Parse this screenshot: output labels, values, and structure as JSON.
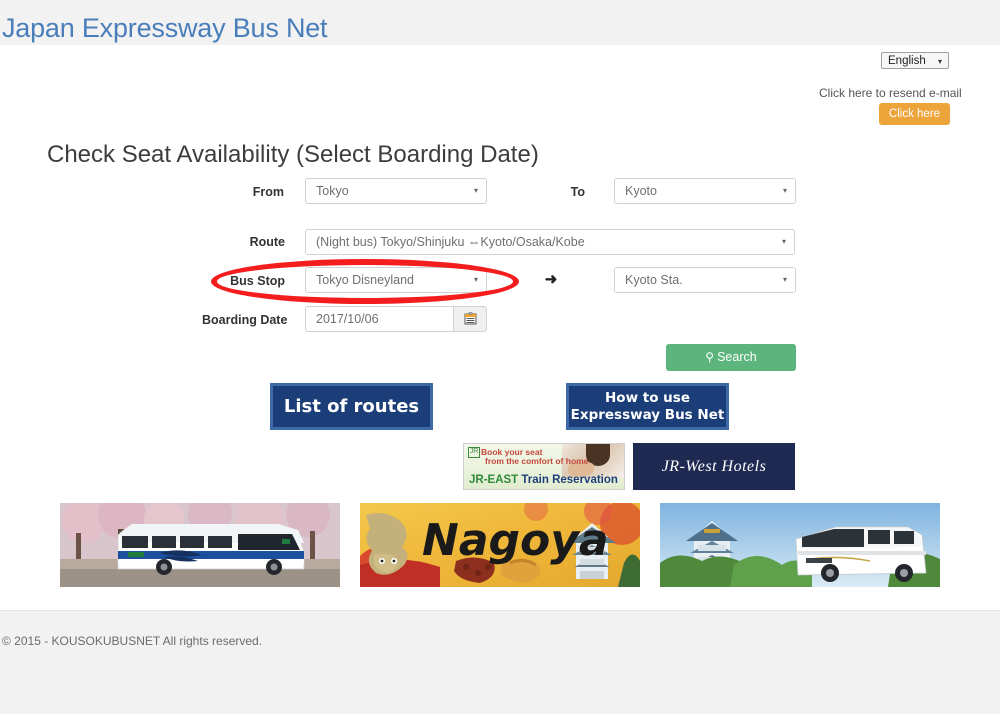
{
  "header": {
    "site_title": "Japan Expressway Bus Net"
  },
  "language": {
    "selected": "English",
    "caret": "▾"
  },
  "resend": {
    "text": "Click here to resend e-mail",
    "button_label": "Click here"
  },
  "main": {
    "heading": "Check Seat Availability (Select Boarding Date)",
    "fields": {
      "from_label": "From",
      "from_value": "Tokyo",
      "to_label": "To",
      "to_value": "Kyoto",
      "route_label": "Route",
      "route_value": "(Night bus) Tokyo/Shinjuku ⇔Kyoto/Osaka/Kobe",
      "bus_stop_label": "Bus Stop",
      "bus_stop_from_value": "Tokyo Disneyland",
      "bus_stop_arrow": "➜",
      "bus_stop_to_value": "Kyoto Sta.",
      "boarding_date_label": "Boarding Date",
      "boarding_date_value": "2017/10/06",
      "caret": "▾"
    },
    "search_button": {
      "icon": "search-icon",
      "glyph": "⚲",
      "label": "Search"
    }
  },
  "nav_buttons": [
    {
      "label": "List of routes",
      "name": "list-of-routes-button"
    },
    {
      "label_line1": "How to use",
      "label_line2": "Expressway Bus Net",
      "name": "how-to-use-button"
    }
  ],
  "banners": {
    "jr_east": {
      "tagline_line1": "Book your seat",
      "tagline_line2": "from the comfort of home",
      "brand_green": "JR-EAST",
      "brand_blue": " Train Reservation",
      "logo_glyph": "JR"
    },
    "jr_west": {
      "label": "JR-West Hotels"
    },
    "photos": [
      {
        "name": "photo-banner-jr-bus-cherry-blossoms",
        "alt": "JR highway bus with cherry blossom trees"
      },
      {
        "name": "photo-banner-nagoya",
        "alt": "Nagoya"
      },
      {
        "name": "photo-banner-osaka-castle-bus",
        "alt": "Osaka Castle with white highway bus"
      }
    ]
  },
  "footer": {
    "copyright": "© 2015 - KOUSOKUBUSNET All rights reserved."
  },
  "colors": {
    "site_title": "#4a7ebb",
    "accent_orange": "#eda43b",
    "accent_green": "#5cb57c",
    "nav_blue": "#1b3d78",
    "annotation_red": "#f41d1d"
  }
}
